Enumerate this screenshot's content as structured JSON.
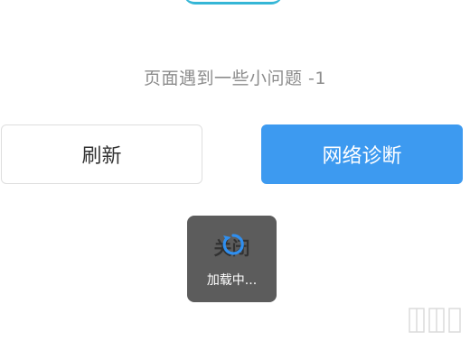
{
  "error": {
    "message": "页面遇到一些小问题 -1"
  },
  "actions": {
    "refresh_label": "刷新",
    "diagnose_label": "网络诊断"
  },
  "loading": {
    "text": "加载中...",
    "background_label": "关闭"
  },
  "colors": {
    "accent": "#3d9af0",
    "toast_bg": "#5c5c5c",
    "message_gray": "#8c8c8c",
    "top_accent": "#35b6d6"
  }
}
